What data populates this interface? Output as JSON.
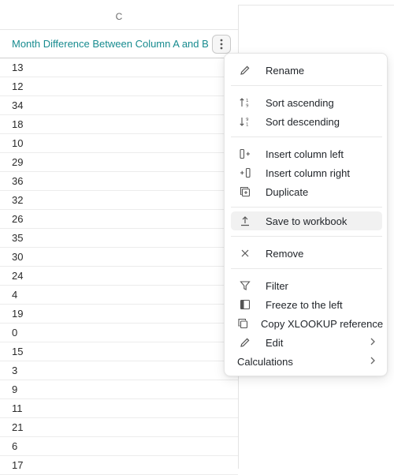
{
  "column": {
    "letter": "C",
    "header_title": "Month Difference Between Column A and B",
    "values": [
      "13",
      "12",
      "34",
      "18",
      "10",
      "29",
      "36",
      "32",
      "26",
      "35",
      "30",
      "24",
      "4",
      "19",
      "0",
      "15",
      "3",
      "9",
      "11",
      "21",
      "6",
      "17"
    ]
  },
  "menu": {
    "rename": "Rename",
    "sort_ascending": "Sort ascending",
    "sort_descending": "Sort descending",
    "insert_left": "Insert column left",
    "insert_right": "Insert column right",
    "duplicate": "Duplicate",
    "save_to_workbook": "Save to workbook",
    "remove": "Remove",
    "filter": "Filter",
    "freeze_left": "Freeze to the left",
    "copy_xlookup": "Copy XLOOKUP reference",
    "edit": "Edit",
    "calculations": "Calculations"
  },
  "icons": {
    "rename": "pencil-icon",
    "sort_ascending": "sort-ascending-icon",
    "sort_descending": "sort-descending-icon",
    "insert_left": "insert-column-left-icon",
    "insert_right": "insert-column-right-icon",
    "duplicate": "duplicate-icon",
    "save": "upload-icon",
    "remove": "close-icon",
    "filter": "filter-icon",
    "freeze": "freeze-column-icon",
    "copy": "copy-icon",
    "edit": "pencil-icon"
  },
  "colors": {
    "header_text": "#178b8f",
    "highlight": "#f1f1f1"
  }
}
